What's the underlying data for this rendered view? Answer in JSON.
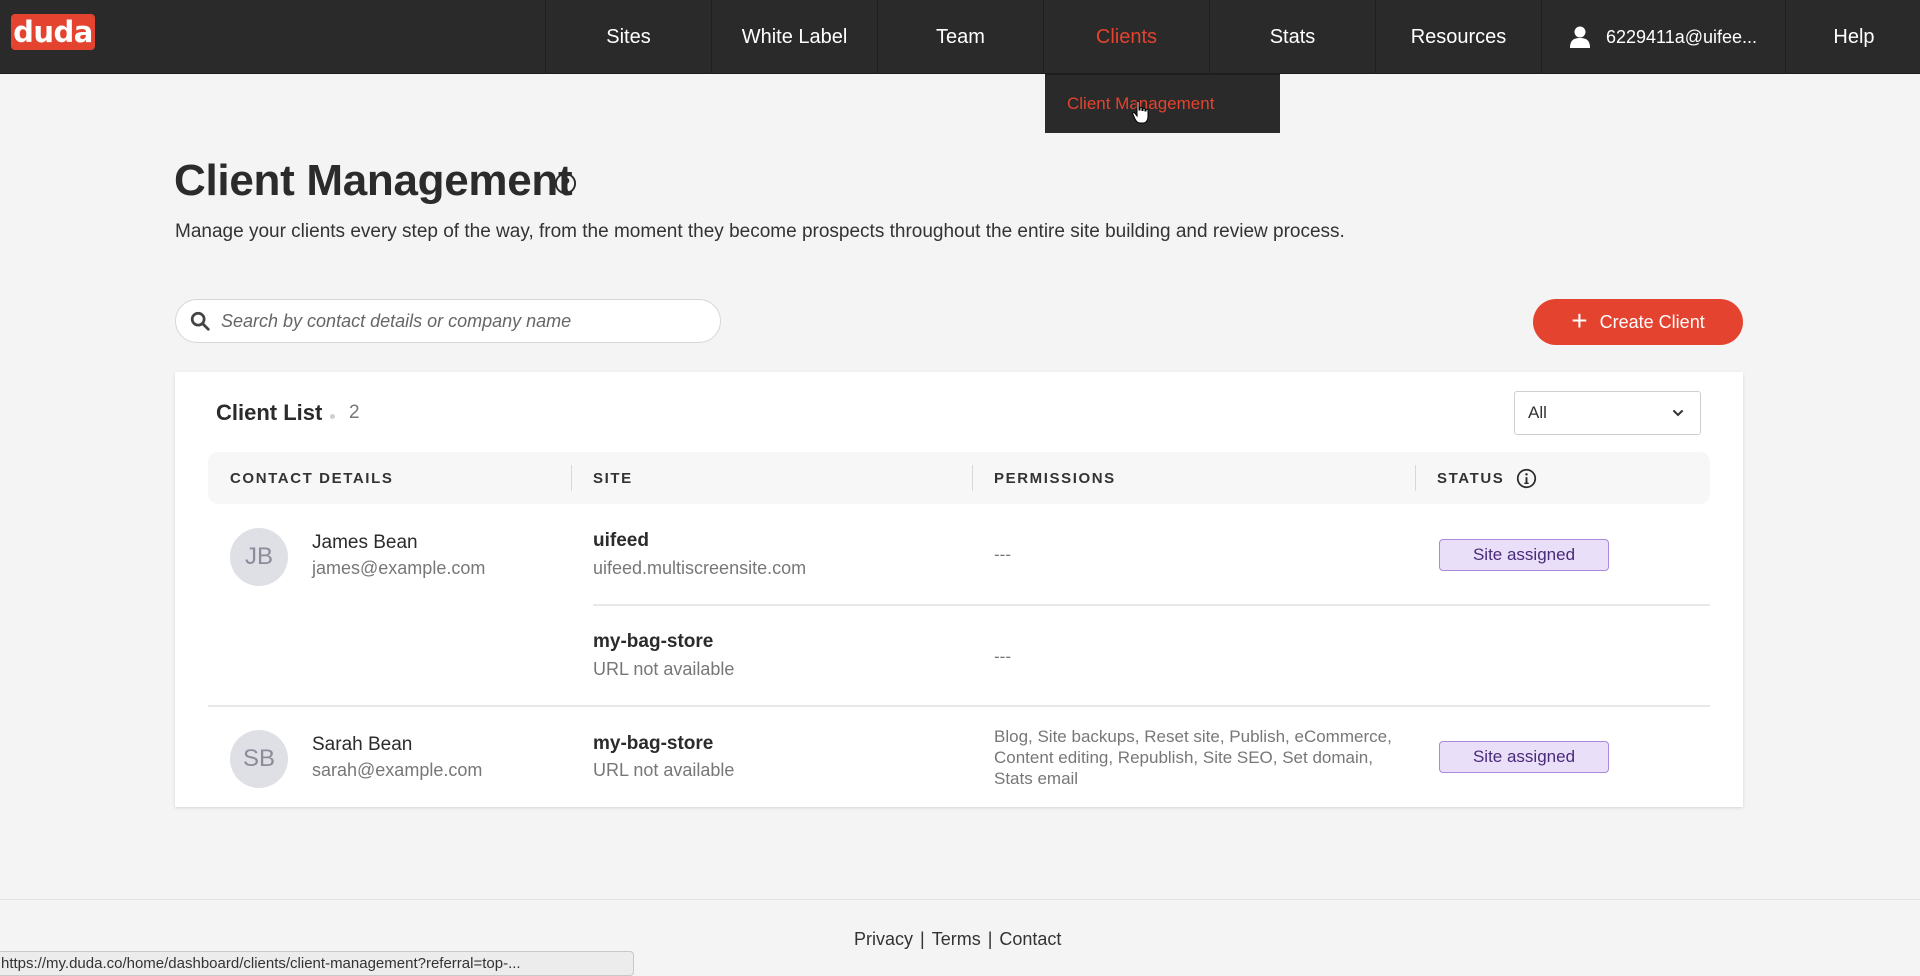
{
  "brand": {
    "logo_text": "duda",
    "accent_color": "#e4432f"
  },
  "nav": {
    "items": [
      {
        "label": "Sites",
        "active": false
      },
      {
        "label": "White Label",
        "active": false
      },
      {
        "label": "Team",
        "active": false
      },
      {
        "label": "Clients",
        "active": true
      },
      {
        "label": "Stats",
        "active": false
      },
      {
        "label": "Resources",
        "active": false
      },
      {
        "label": "6229411a@uifee...",
        "icon": "user-icon",
        "active": false
      },
      {
        "label": "Help",
        "active": false
      }
    ],
    "dropdown": {
      "items": [
        {
          "label": "Client Management"
        }
      ]
    }
  },
  "page": {
    "title": "Client Management",
    "subtitle": "Manage your clients every step of the way, from the moment they become prospects throughout the entire site building and review process."
  },
  "search": {
    "placeholder": "Search by contact details or company name",
    "value": ""
  },
  "create_button": {
    "label": "Create Client",
    "icon": "plus-icon"
  },
  "client_list": {
    "title": "Client List",
    "count": "2",
    "filter": {
      "selected": "All"
    },
    "columns": [
      "CONTACT DETAILS",
      "SITE",
      "PERMISSIONS",
      "STATUS"
    ],
    "clients": [
      {
        "initials": "JB",
        "name": "James Bean",
        "email": "james@example.com",
        "status": "Site assigned",
        "sites": [
          {
            "name": "uifeed",
            "url": "uifeed.multiscreensite.com",
            "permissions": "---"
          },
          {
            "name": "my-bag-store",
            "url": "URL not available",
            "permissions": "---"
          }
        ]
      },
      {
        "initials": "SB",
        "name": "Sarah Bean",
        "email": "sarah@example.com",
        "status": "Site assigned",
        "sites": [
          {
            "name": "my-bag-store",
            "url": "URL not available",
            "permissions": "Blog, Site backups, Reset site, Publish, eCommerce, Content editing, Republish, Site SEO, Set domain, Stats email"
          }
        ]
      }
    ]
  },
  "footer": {
    "links": [
      "Privacy",
      "Terms",
      "Contact"
    ],
    "separator": "|"
  },
  "status_bar": {
    "url": "https://my.duda.co/home/dashboard/clients/client-management?referral=top-..."
  }
}
